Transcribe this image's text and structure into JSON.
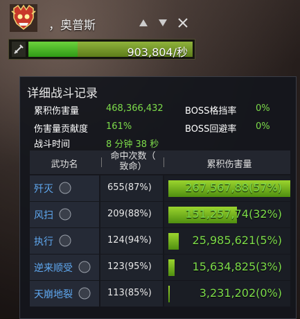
{
  "boss": {
    "name": "，奥普斯"
  },
  "dps": {
    "value": "903,804/秒",
    "fill": 0.3
  },
  "panel": {
    "title": "详细战斗记录",
    "stats": {
      "total_damage_label": "累积伤害量",
      "total_damage_value": "468,366,432",
      "contribution_label": "伤害量贡献度",
      "contribution_value": "161%",
      "duration_label": "战斗时间",
      "duration_value": "8 分钟 38 秒",
      "boss_block_label": "BOSS格挡率",
      "boss_block_value": "0%",
      "boss_evade_label": "BOSS回避率",
      "boss_evade_value": "0%"
    },
    "table": {
      "col_skill": "武功名",
      "col_hits_line1": "命中次数（",
      "col_hits_line2": "致命）",
      "col_damage": "累积伤害量",
      "rows": [
        {
          "skill": "歼灭",
          "hits": "655(87%)",
          "damage": "267,567,88(57%)",
          "pct": 57
        },
        {
          "skill": "风扫",
          "hits": "209(88%)",
          "damage": "151,257,74(32%)",
          "pct": 32
        },
        {
          "skill": "执行",
          "hits": "124(94%)",
          "damage": "25,985,621(5%)",
          "pct": 5
        },
        {
          "skill": "逆来顺受",
          "hits": "123(95%)",
          "damage": "15,634,825(3%)",
          "pct": 3
        },
        {
          "skill": "天崩地裂",
          "hits": "113(85%)",
          "damage": "3,231,202(0%)",
          "pct": 0.7
        }
      ]
    }
  }
}
